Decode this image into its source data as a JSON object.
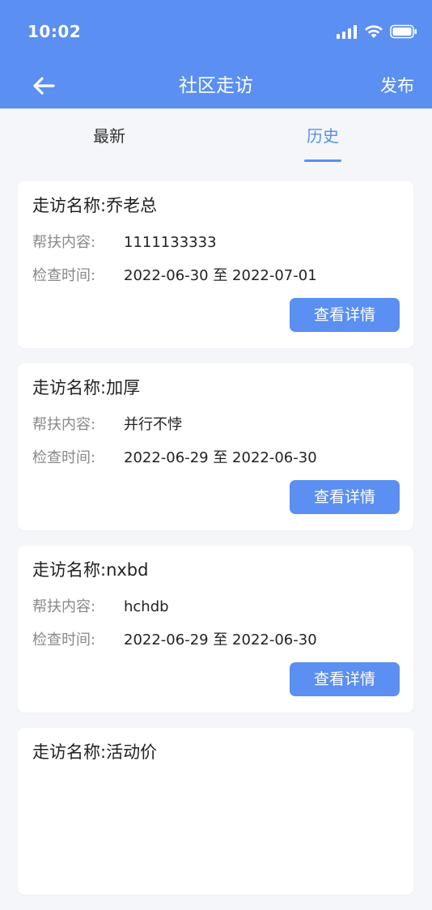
{
  "status_bar": {
    "time": "10:02"
  },
  "navbar": {
    "title": "社区走访",
    "publish_label": "发布"
  },
  "tabs": [
    {
      "label": "最新",
      "active": false
    },
    {
      "label": "历史",
      "active": true
    }
  ],
  "labels": {
    "content": "帮扶内容:",
    "time": "检查时间:",
    "detail_button": "查看详情"
  },
  "cards": [
    {
      "title": "走访名称:乔老总",
      "content": "1111133333",
      "time": "2022-06-30 至 2022-07-01"
    },
    {
      "title": "走访名称:加厚",
      "content": "并行不悖",
      "time": "2022-06-29 至 2022-06-30"
    },
    {
      "title": "走访名称:nxbd",
      "content": "hchdb",
      "time": "2022-06-29 至 2022-06-30"
    },
    {
      "title": "走访名称:活动价",
      "content": "",
      "time": ""
    }
  ],
  "colors": {
    "primary": "#5b8ff1",
    "background": "#f4f6fa",
    "label": "#888888"
  }
}
